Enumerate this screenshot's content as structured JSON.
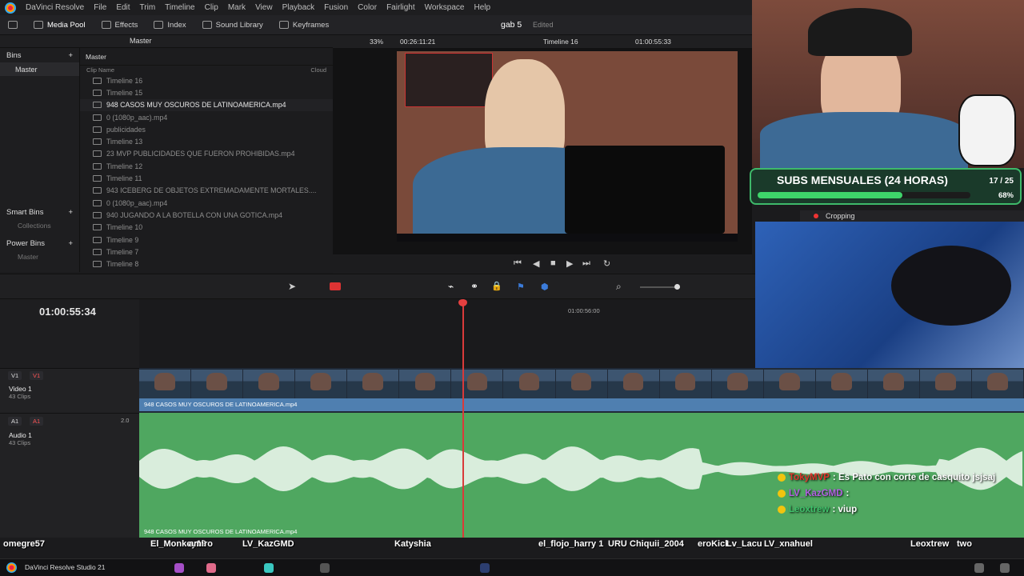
{
  "menubar": {
    "app_name": "DaVinci Resolve",
    "items": [
      "File",
      "Edit",
      "Trim",
      "Timeline",
      "Clip",
      "Mark",
      "View",
      "Playback",
      "Fusion",
      "Color",
      "Fairlight",
      "Workspace",
      "Help"
    ]
  },
  "toolbar": {
    "tabs": [
      "Media Pool",
      "Effects",
      "Index",
      "Sound Library",
      "Keyframes"
    ],
    "project_title": "gab 5",
    "project_state": "Edited"
  },
  "subbar": {
    "pool_title": "Master",
    "zoom": "33%",
    "source_tc": "00:26:11:21",
    "timeline_name": "Timeline 16",
    "record_tc": "01:00:55:33"
  },
  "bins": {
    "header": "Bins",
    "items": [
      "Master"
    ],
    "smart_bins": "Smart Bins",
    "collections": "Collections",
    "power_bins": "Power Bins",
    "power_master": "Master"
  },
  "pool": {
    "breadcrumb": "Master",
    "col_name": "Clip Name",
    "col_cloud": "Cloud",
    "clips": [
      {
        "name": "Timeline 16",
        "hl": false
      },
      {
        "name": "Timeline 15",
        "hl": false
      },
      {
        "name": "948 CASOS MUY OSCUROS DE LATINOAMERICA.mp4",
        "hl": true
      },
      {
        "name": "0 (1080p_aac).mp4",
        "hl": false
      },
      {
        "name": "publicidades",
        "hl": false
      },
      {
        "name": "Timeline 13",
        "hl": false
      },
      {
        "name": "23 MVP PUBLICIDADES QUE FUERON PROHIBIDAS.mp4",
        "hl": false
      },
      {
        "name": "Timeline 12",
        "hl": false
      },
      {
        "name": "Timeline 11",
        "hl": false
      },
      {
        "name": "943 ICEBERG DE OBJETOS EXTREMADAMENTE MORTALES....",
        "hl": false
      },
      {
        "name": "0 (1080p_aac).mp4",
        "hl": false
      },
      {
        "name": "940 JUGANDO A LA BOTELLA CON UNA GOTICA.mp4",
        "hl": false
      },
      {
        "name": "Timeline 10",
        "hl": false
      },
      {
        "name": "Timeline 9",
        "hl": false
      },
      {
        "name": "Timeline 7",
        "hl": false
      },
      {
        "name": "Timeline 8",
        "hl": false
      }
    ]
  },
  "timeline": {
    "timecode": "01:00:55:34",
    "ruler_mark": "01:00:56:00",
    "video_track": {
      "id": "V1",
      "name": "Video 1",
      "clips": "43 Clips",
      "clip_label": "948 CASOS MUY OSCUROS DE LATINOAMERICA.mp4"
    },
    "audio_track": {
      "id": "A1",
      "name": "Audio 1",
      "clips": "43 Clips",
      "level": "2.0",
      "clip_label": "948 CASOS MUY OSCUROS DE LATINOAMERICA.mp4"
    }
  },
  "overlay": {
    "subs_title": "SUBS MENSUALES (24 HORAS)",
    "subs_count": "17 / 25",
    "subs_pct": "68%",
    "subs_fraction": 0.68,
    "crop_label": "Cropping"
  },
  "chat": [
    {
      "user": "TokyMVP",
      "text": ": Es Pato con corte de casquito jsjsaj",
      "color": "#e0342c"
    },
    {
      "user": "LV_KazGMD",
      "text": ":",
      "color": "#b060e0"
    },
    {
      "user": "Leoxtrew",
      "text": ": viup",
      "color": "#3ec06a"
    }
  ],
  "names": [
    "omegre57",
    "El_Monkey19",
    "amiro",
    "LV_KazGMD",
    "Katyshia",
    "el_flojo_harry 1",
    "URU",
    "Chiquii_2004",
    "eroKick",
    "Lv_Lacu",
    "LV_xnahuel",
    "Leoxtrew",
    "two"
  ],
  "taskbar": {
    "app_label": "DaVinci Resolve Studio 21"
  },
  "colors": {
    "accent_green": "#3ed46a",
    "playhead": "#d93a3a",
    "video_clip": "#4f7fb0",
    "audio_clip": "#4fa760"
  }
}
